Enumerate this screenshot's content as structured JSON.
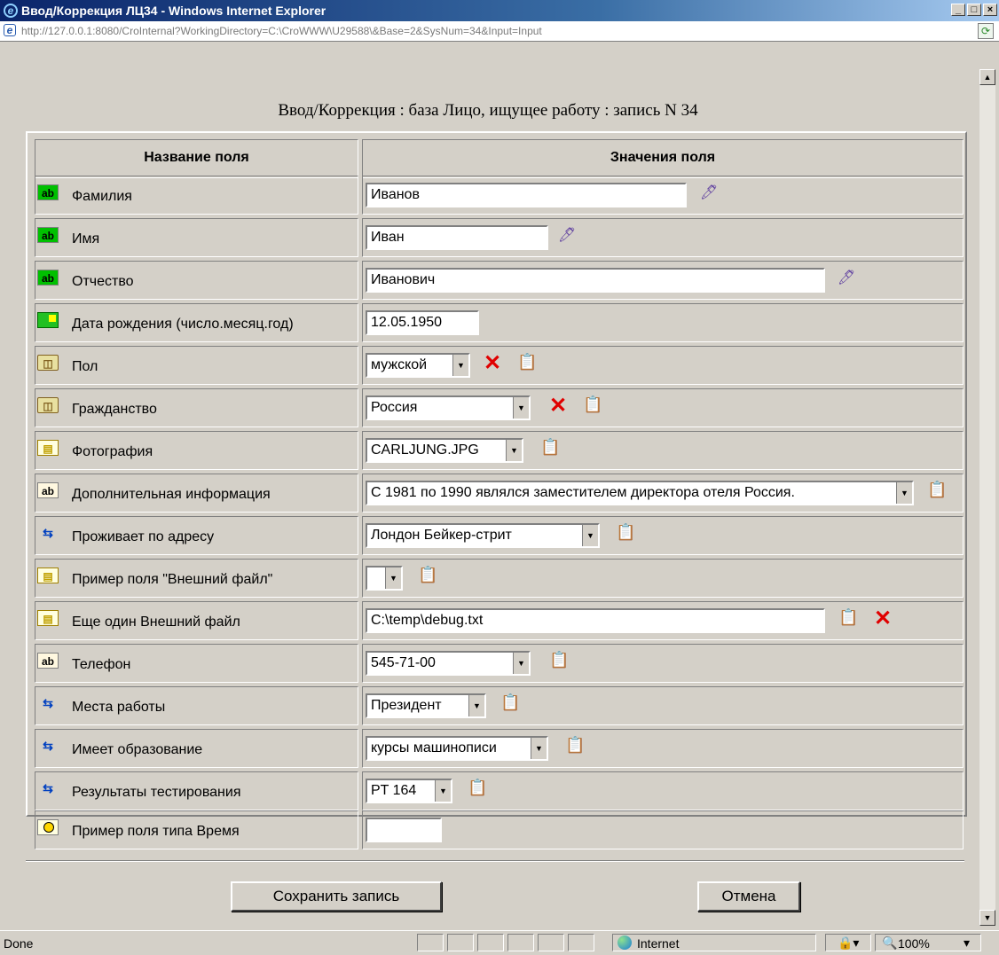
{
  "window": {
    "title": "Ввод/Коррекция ЛЦ34 - Windows Internet Explorer"
  },
  "address": {
    "url": "http://127.0.0.1:8080/CroInternal?WorkingDirectory=C:\\CroWWW\\U29588\\&Base=2&SysNum=34&Input=Input"
  },
  "page": {
    "heading": "Ввод/Коррекция : база Лицо, ищущее работу : запись N 34"
  },
  "table": {
    "col1": "Название поля",
    "col2": "Значения поля",
    "rows": [
      {
        "label": "Фамилия",
        "value": "Иванов",
        "icon": "ab-text-icon"
      },
      {
        "label": "Имя",
        "value": "Иван",
        "icon": "ab-text-icon"
      },
      {
        "label": "Отчество",
        "value": "Иванович",
        "icon": "ab-text-icon"
      },
      {
        "label": "Дата рождения (число.месяц.год)",
        "value": "12.05.1950",
        "icon": "date-icon"
      },
      {
        "label": "Пол",
        "value": "мужской",
        "icon": "book-icon"
      },
      {
        "label": "Гражданство",
        "value": "Россия",
        "icon": "book-icon"
      },
      {
        "label": "Фотография",
        "value": "CARLJUNG.JPG",
        "icon": "file-icon"
      },
      {
        "label": "Дополнительная информация",
        "value": "С 1981 по 1990 являлся заместителем директора отеля Россия.",
        "icon": "memo-icon"
      },
      {
        "label": "Проживает по адресу",
        "value": "Лондон Бейкер-стрит",
        "icon": "link-icon"
      },
      {
        "label": "Пример поля \"Внешний файл\"",
        "value": "",
        "icon": "file-icon"
      },
      {
        "label": "Еще один Внешний файл",
        "value": "C:\\temp\\debug.txt",
        "icon": "file-icon"
      },
      {
        "label": "Телефон",
        "value": "545-71-00",
        "icon": "memo-icon"
      },
      {
        "label": "Места работы",
        "value": "Президент",
        "icon": "link-icon"
      },
      {
        "label": "Имеет образование",
        "value": "курсы машинописи",
        "icon": "link-icon"
      },
      {
        "label": "Результаты тестирования",
        "value": "PT 164",
        "icon": "link-icon"
      },
      {
        "label": "Пример поля типа Время",
        "value": "",
        "icon": "time-icon"
      }
    ]
  },
  "buttons": {
    "save": "Сохранить запись",
    "cancel": "Отмена"
  },
  "statusbar": {
    "text": "Done",
    "zone": "Internet",
    "zoom": "100%"
  }
}
